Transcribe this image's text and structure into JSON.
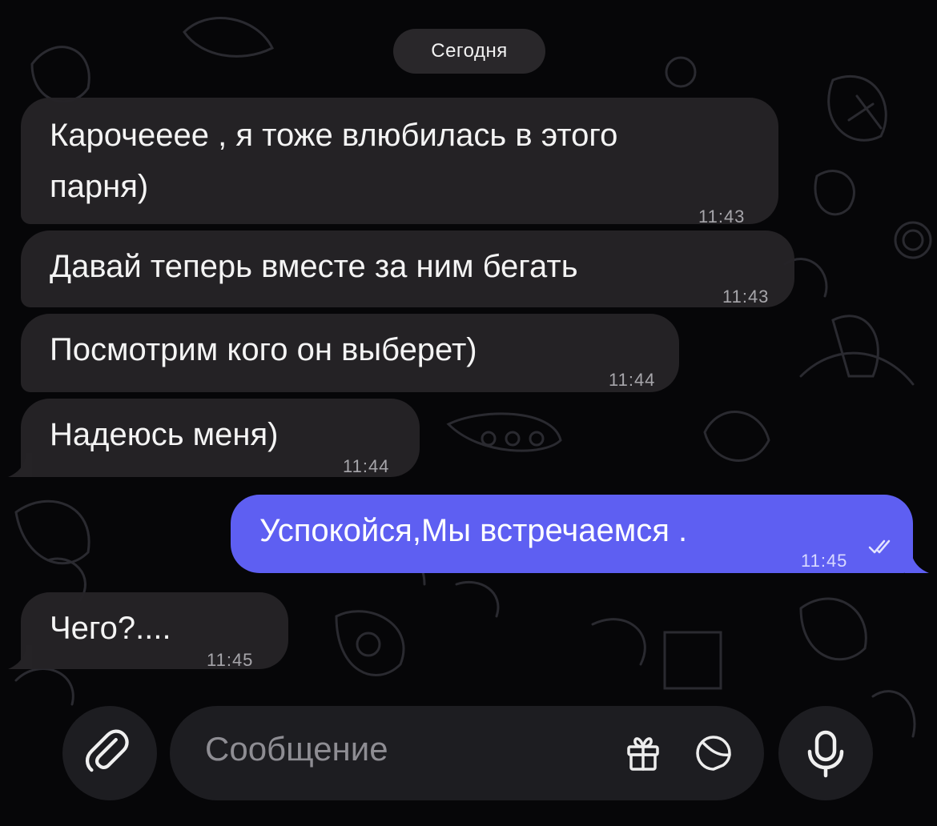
{
  "chat": {
    "date_separator": "Сегодня",
    "messages": [
      {
        "direction": "incoming",
        "text_line1": "Карочееее , я тоже влюбилась в этого",
        "text_line2": "парня)",
        "time": "11:43"
      },
      {
        "direction": "incoming",
        "text": "Давай теперь вместе за ним бегать",
        "time": "11:43"
      },
      {
        "direction": "incoming",
        "text": "Посмотрим кого он выберет)",
        "time": "11:44"
      },
      {
        "direction": "incoming",
        "text": "Надеюсь меня)",
        "time": "11:44"
      },
      {
        "direction": "outgoing",
        "text": "Успокойся,Мы встречаемся .",
        "time": "11:45",
        "status": "read"
      },
      {
        "direction": "incoming",
        "text": "Чего?....",
        "time": "11:45"
      }
    ]
  },
  "composer": {
    "placeholder": "Сообщение",
    "attach_icon": "paperclip-icon",
    "gift_icon": "gift-icon",
    "sticker_icon": "sticker-icon",
    "mic_icon": "microphone-icon"
  },
  "colors": {
    "background": "#060608",
    "incoming_bubble": "#252326",
    "outgoing_bubble": "#5e5ff2",
    "timestamp": "#a7a6ab"
  }
}
